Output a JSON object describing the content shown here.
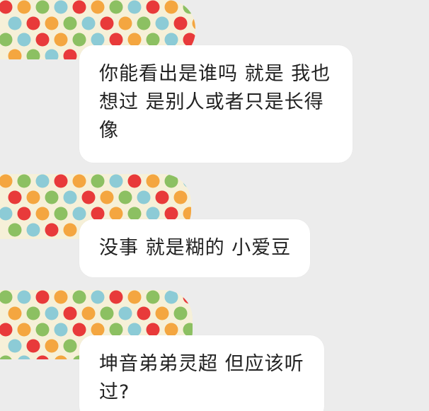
{
  "conversation": {
    "messages": [
      {
        "avatar_icon": "polka-dot-mask-icon",
        "text": "你能看出是谁吗 就是 我也想过 是别人或者只是长得像"
      },
      {
        "avatar_icon": "polka-dot-mask-icon",
        "text": "没事 就是糊的 小爱豆"
      },
      {
        "avatar_icon": "polka-dot-mask-icon",
        "text": "坤音弟弟灵超 但应该听过?"
      }
    ]
  },
  "colors": {
    "background": "#ececec",
    "bubble": "#ffffff",
    "text": "#222222",
    "dot_red": "#e83a3a",
    "dot_orange": "#f4a640",
    "dot_green": "#8cc062",
    "dot_blue": "#8ccbd6",
    "mask_base": "#f6f0d8"
  }
}
